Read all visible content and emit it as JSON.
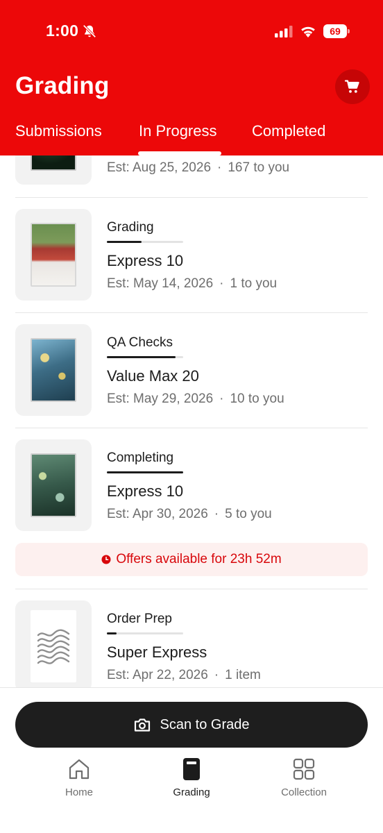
{
  "status_bar": {
    "time": "1:00",
    "battery": "69"
  },
  "header": {
    "title": "Grading",
    "cart_icon": "cart-icon",
    "accent": "#ec0809"
  },
  "tabs": [
    {
      "label": "Submissions",
      "active": false
    },
    {
      "label": "In Progress",
      "active": true
    },
    {
      "label": "Completed",
      "active": false
    }
  ],
  "submissions": [
    {
      "status": "",
      "progress": null,
      "service": "",
      "est": "Est: Aug 25, 2026",
      "count": "167 to you"
    },
    {
      "status": "Grading",
      "progress": 0.45,
      "service": "Express 10",
      "est": "Est: May 14, 2026",
      "count": "1 to you"
    },
    {
      "status": "QA Checks",
      "progress": 0.9,
      "service": "Value Max 20",
      "est": "Est: May 29, 2026",
      "count": "10 to you"
    },
    {
      "status": "Completing",
      "progress": 1.0,
      "service": "Express 10",
      "est": "Est: Apr 30, 2026",
      "count": "5 to you"
    },
    {
      "status": "Order Prep",
      "progress": 0.13,
      "service": "Super Express",
      "est": "Est: Apr 22, 2026",
      "count": "1 item"
    }
  ],
  "offer_banner": {
    "text": "Offers available for 23h 52m",
    "icon": "clock-icon",
    "color": "#d8070b"
  },
  "scan_button": {
    "label": "Scan to Grade",
    "icon": "camera-icon"
  },
  "bottom_nav": [
    {
      "label": "Home",
      "icon": "home-icon",
      "active": false
    },
    {
      "label": "Grading",
      "icon": "grading-icon",
      "active": true
    },
    {
      "label": "Collection",
      "icon": "collection-icon",
      "active": false
    }
  ]
}
